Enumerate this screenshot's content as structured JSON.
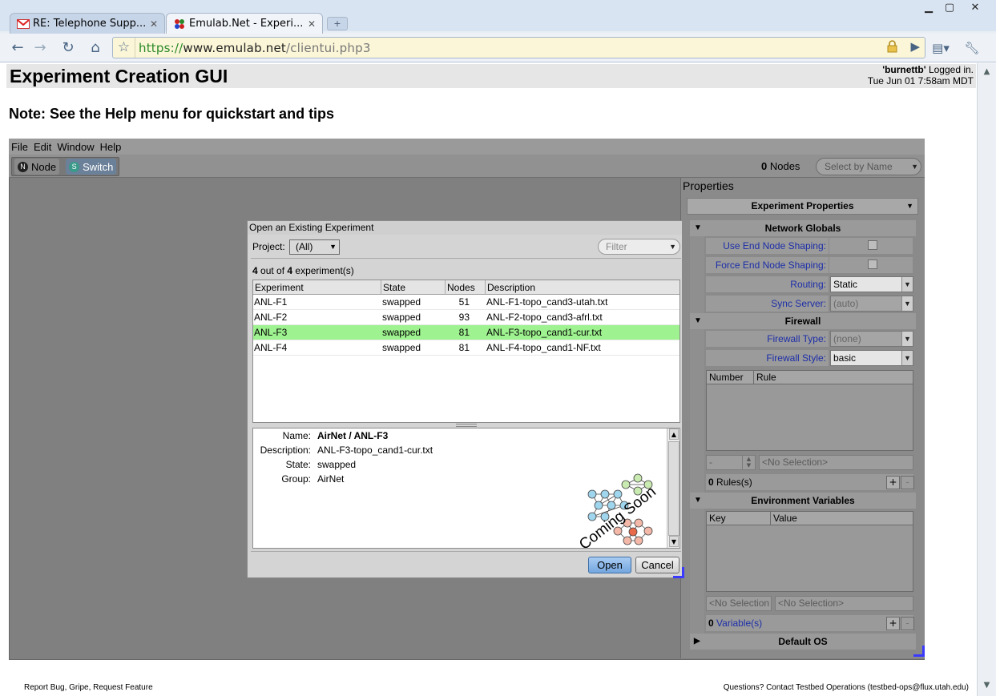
{
  "browser": {
    "tabs": [
      {
        "title": "RE: Telephone Supp...",
        "favicon": "gmail-icon"
      },
      {
        "title": "Emulab.Net - Experi...",
        "favicon": "emulab-icon"
      }
    ],
    "url": {
      "scheme": "https://",
      "domain": "www.emulab.net",
      "path": "/clientui.php3"
    }
  },
  "page": {
    "title": "Experiment Creation GUI",
    "login_user": "'burnettb'",
    "login_suffix": " Logged in.",
    "datetime": "Tue Jun 01 7:58am MDT",
    "note": "Note: See the Help menu for quickstart and tips",
    "footer_left": "Report Bug, Gripe, Request Feature",
    "footer_right_prefix": "Questions? Contact ",
    "footer_right_link": "Testbed Operations",
    "footer_right_suffix": " (testbed-ops@flux.utah.edu)"
  },
  "applet": {
    "menus": [
      "File",
      "Edit",
      "Window",
      "Help"
    ],
    "tools": [
      {
        "label": "Node",
        "icon": "N"
      },
      {
        "label": "Switch",
        "icon": "S"
      }
    ],
    "node_count": "0",
    "node_count_label": " Nodes",
    "select_by_name_placeholder": "Select by Name"
  },
  "properties": {
    "title": "Properties",
    "selector": "Experiment Properties",
    "sections": {
      "network_globals": "Network Globals",
      "firewall": "Firewall",
      "env_vars": "Environment Variables",
      "default_os": "Default OS"
    },
    "use_end_node_shaping": "Use End Node Shaping:",
    "force_end_node_shaping": "Force End Node Shaping:",
    "routing_label": "Routing:",
    "routing_value": "Static",
    "sync_server_label": "Sync Server:",
    "sync_server_value": "(auto)",
    "firewall_type_label": "Firewall Type:",
    "firewall_type_value": "(none)",
    "firewall_style_label": "Firewall Style:",
    "firewall_style_value": "basic",
    "rules_columns": [
      "Number",
      "Rule"
    ],
    "rule_number_value": "-",
    "rule_value_placeholder": "<No Selection>",
    "rules_count": "0",
    "rules_label": " Rules(s)",
    "env_columns": [
      "Key",
      "Value"
    ],
    "env_key_placeholder": "<No Selection",
    "env_value_placeholder": "<No Selection>",
    "vars_count": "0",
    "vars_label": "Variable(s)"
  },
  "dialog": {
    "title": "Open an Existing Experiment",
    "project_label": "Project:",
    "project_value": "(All)",
    "filter_placeholder": "Filter",
    "count_shown": "4",
    "count_mid": " out of ",
    "count_total": "4",
    "count_suffix": " experiment(s)",
    "columns": [
      "Experiment",
      "State",
      "Nodes",
      "Description"
    ],
    "rows": [
      {
        "experiment": "ANL-F1",
        "state": "swapped",
        "nodes": "51",
        "description": "ANL-F1-topo_cand3-utah.txt"
      },
      {
        "experiment": "ANL-F2",
        "state": "swapped",
        "nodes": "93",
        "description": "ANL-F2-topo_cand3-afrl.txt"
      },
      {
        "experiment": "ANL-F3",
        "state": "swapped",
        "nodes": "81",
        "description": "ANL-F3-topo_cand1-cur.txt"
      },
      {
        "experiment": "ANL-F4",
        "state": "swapped",
        "nodes": "81",
        "description": "ANL-F4-topo_cand1-NF.txt"
      }
    ],
    "selected_index": 2,
    "details": {
      "name_label": "Name:",
      "name_project": "AirNet",
      "name_sep": " / ",
      "name_exp": "ANL-F3",
      "description_label": "Description:",
      "description_value": "ANL-F3-topo_cand1-cur.txt",
      "state_label": "State:",
      "state_value": "swapped",
      "group_label": "Group:",
      "group_value": "AirNet",
      "preview_text": "Coming Soon"
    },
    "open_label": "Open",
    "cancel_label": "Cancel"
  },
  "colors": {
    "selected_row": "#9ef28f",
    "property_label": "#1c2ea8",
    "applet_background": "#808080"
  }
}
